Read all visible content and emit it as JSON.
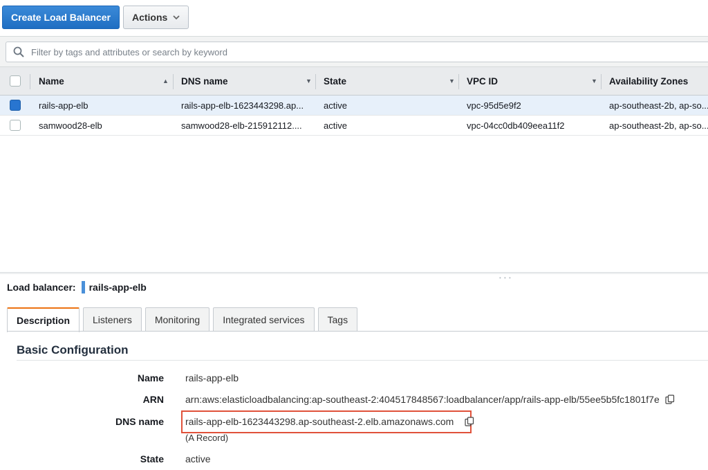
{
  "toolbar": {
    "create_label": "Create Load Balancer",
    "actions_label": "Actions"
  },
  "filter": {
    "placeholder": "Filter by tags and attributes or search by keyword",
    "search_icon": "search-icon"
  },
  "table": {
    "columns": [
      "Name",
      "DNS name",
      "State",
      "VPC ID",
      "Availability Zones"
    ],
    "rows": [
      {
        "selected": true,
        "name": "rails-app-elb",
        "dns": "rails-app-elb-1623443298.ap...",
        "state": "active",
        "vpc": "vpc-95d5e9f2",
        "az": "ap-southeast-2b, ap-so..."
      },
      {
        "selected": false,
        "name": "samwood28-elb",
        "dns": "samwood28-elb-215912112....",
        "state": "active",
        "vpc": "vpc-04cc0db409eea11f2",
        "az": "ap-southeast-2b, ap-so..."
      }
    ]
  },
  "details": {
    "header_label": "Load balancer:",
    "header_name": "rails-app-elb",
    "tabs": [
      "Description",
      "Listeners",
      "Monitoring",
      "Integrated services",
      "Tags"
    ],
    "section_title": "Basic Configuration",
    "fields": {
      "name_label": "Name",
      "name_value": "rails-app-elb",
      "arn_label": "ARN",
      "arn_value": "arn:aws:elasticloadbalancing:ap-southeast-2:404517848567:loadbalancer/app/rails-app-elb/55ee5b5fc1801f7e",
      "dns_label": "DNS name",
      "dns_value": "rails-app-elb-1623443298.ap-southeast-2.elb.amazonaws.com",
      "dns_sub": "(A Record)",
      "state_label": "State",
      "state_value": "active"
    }
  },
  "colors": {
    "primary": "#1f6ec2",
    "highlight_border": "#e0513a",
    "active_tab": "#ec7211",
    "selected_row": "#e7f0fa"
  }
}
